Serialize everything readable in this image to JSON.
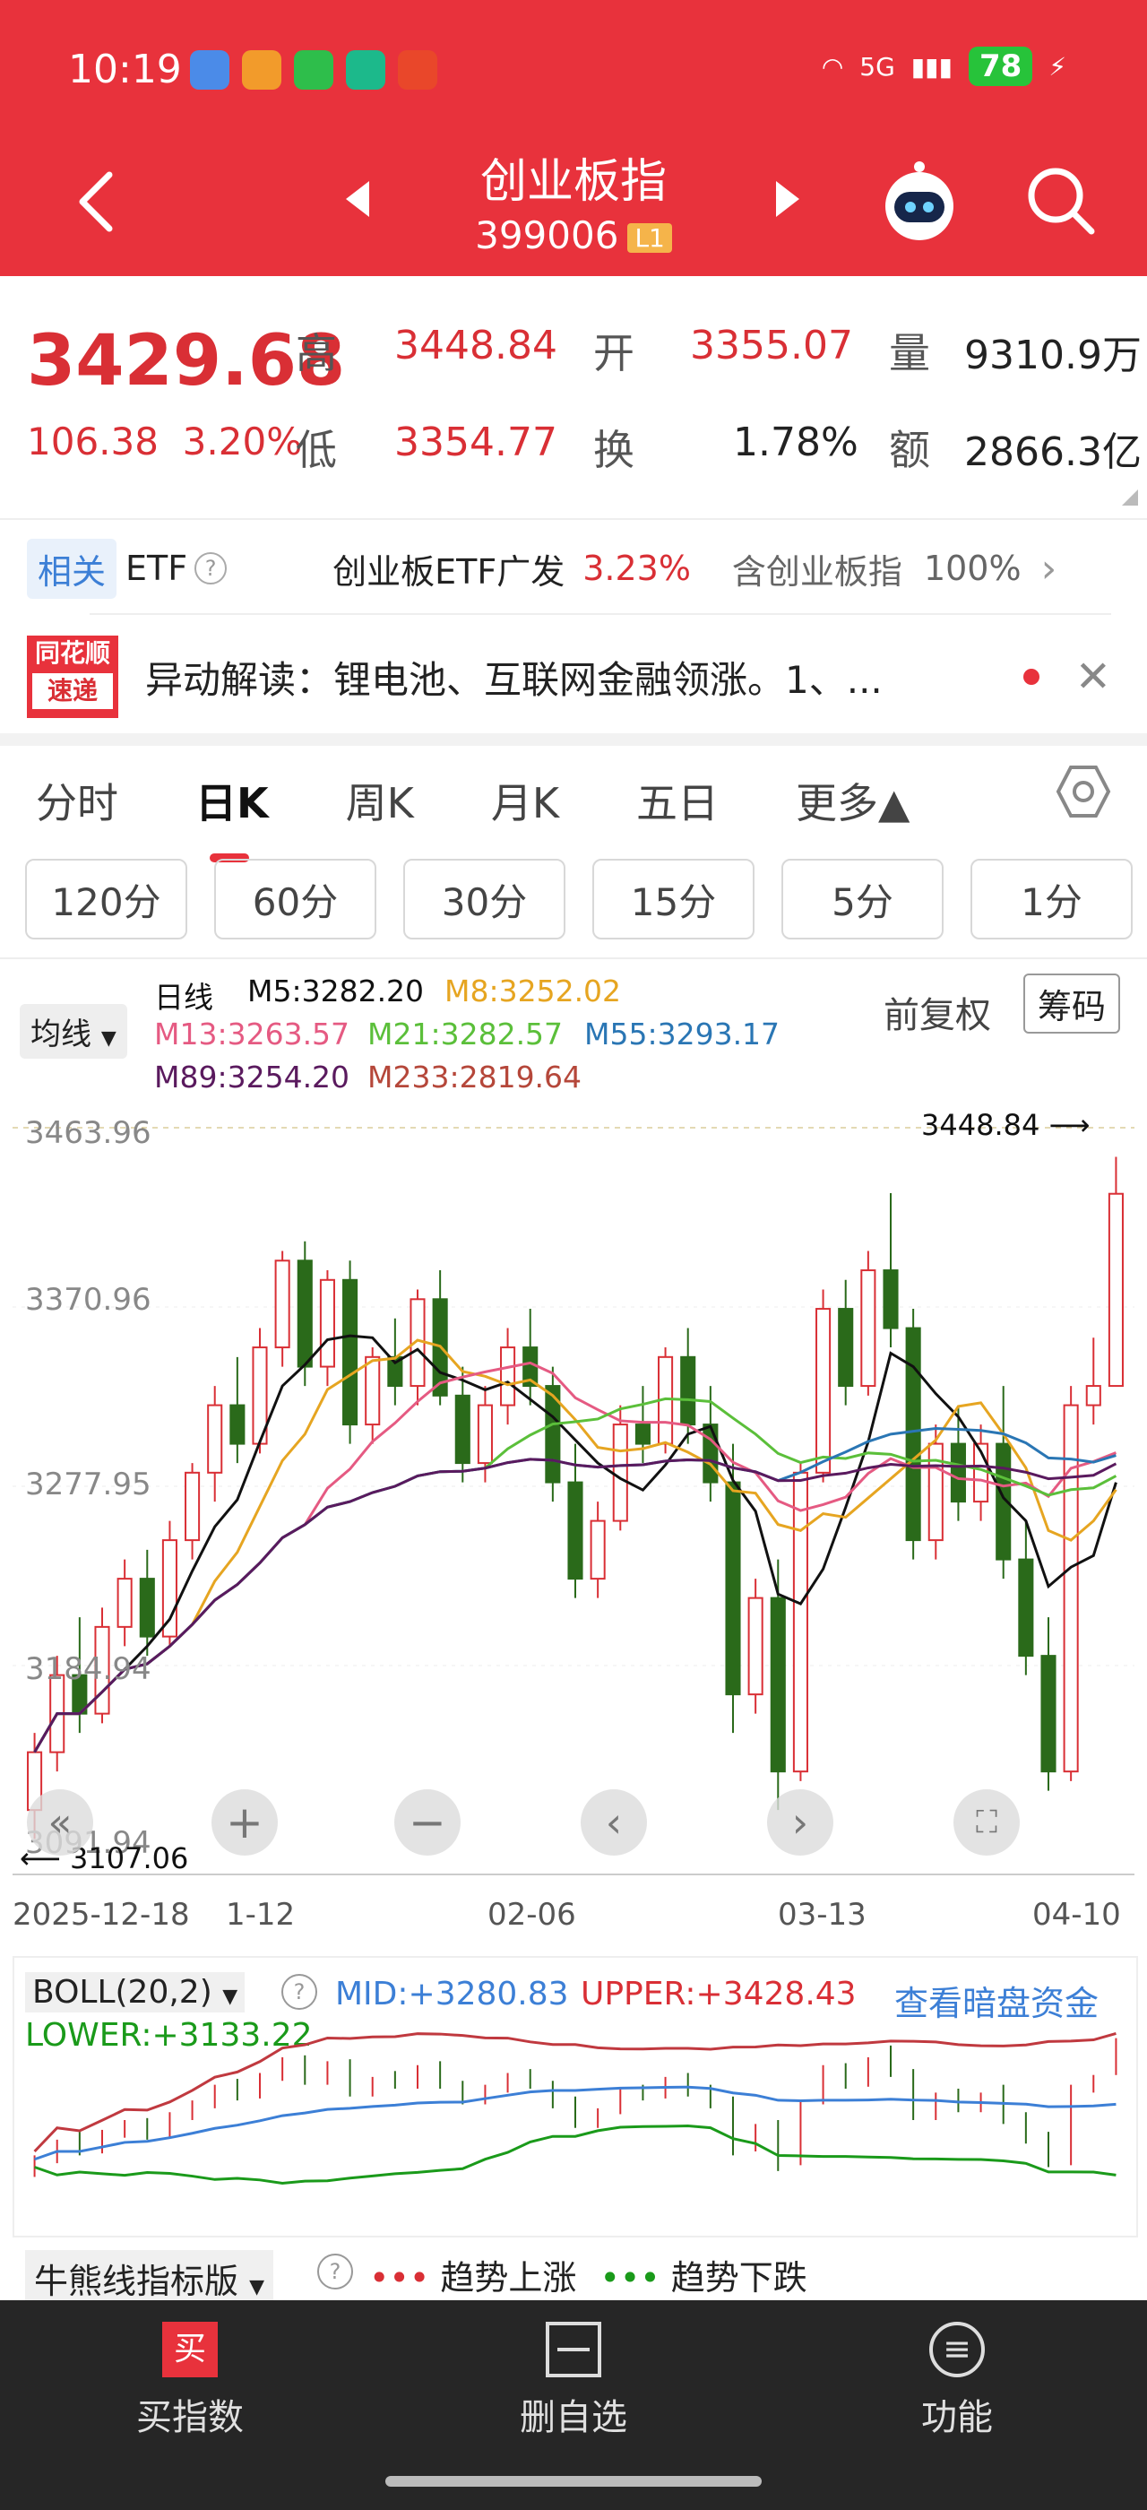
{
  "status_bar": {
    "time": "10:19",
    "signal": "5G",
    "battery": "78"
  },
  "header": {
    "title": "创业板指",
    "code": "399006",
    "level_badge": "L1",
    "icons": [
      "back-icon",
      "prev-icon",
      "next-icon",
      "robot-icon",
      "search-icon"
    ]
  },
  "quote": {
    "price": "3429.68",
    "change": "106.38",
    "change_pct": "3.20%",
    "high_label": "高",
    "high": "3448.84",
    "open_label": "开",
    "open": "3355.07",
    "volume_label": "量",
    "volume": "9310.9万",
    "low_label": "低",
    "low": "3354.77",
    "turnover_label": "换",
    "turnover": "1.78%",
    "amount_label": "额",
    "amount": "2866.3亿"
  },
  "etf": {
    "tag": "相关",
    "label": "ETF",
    "name": "创业板ETF广发",
    "pct": "3.23%",
    "contains": "含创业板指",
    "weight": "100%"
  },
  "news": {
    "logo_top": "同花顺",
    "logo_bottom": "速递",
    "text": "异动解读：锂电池、互联网金融领涨。1、..."
  },
  "tabs": {
    "items": [
      "分时",
      "日K",
      "周K",
      "月K",
      "五日",
      "更多▲"
    ],
    "active": "日K"
  },
  "periods": [
    "120分",
    "60分",
    "30分",
    "15分",
    "5分",
    "1分"
  ],
  "chart_panel": {
    "ma_dropdown": "均线",
    "line_type": "日线",
    "ma_values": [
      {
        "label": "M5:3282.20",
        "color": "#111111"
      },
      {
        "label": "M8:3252.02",
        "color": "#e6a521"
      },
      {
        "label": "M13:3263.57",
        "color": "#e55a82"
      },
      {
        "label": "M21:3282.57",
        "color": "#5bbf3a"
      },
      {
        "label": "M55:3293.17",
        "color": "#2a76b4"
      },
      {
        "label": "M89:3254.20",
        "color": "#5a1a5e"
      },
      {
        "label": "M233:2819.64",
        "color": "#b5473a"
      }
    ],
    "adjust": "前复权",
    "chips_button": "筹码",
    "price_axis": [
      "3463.96",
      "3370.96",
      "3277.95",
      "3184.94",
      "3091.94"
    ],
    "max_marker": "3448.84",
    "min_marker": "3107.06",
    "date_axis": [
      "2025-12-18",
      "1-12",
      "02-06",
      "03-13",
      "04-10"
    ]
  },
  "chart_data": {
    "type": "candlestick",
    "ylim": [
      3091.94,
      3463.96
    ],
    "x": [
      "2025-12-18",
      "1-12",
      "02-06",
      "03-13",
      "04-10"
    ],
    "ohlc": [
      [
        3110,
        3150,
        3095,
        3140
      ],
      [
        3140,
        3190,
        3130,
        3180
      ],
      [
        3180,
        3210,
        3150,
        3160
      ],
      [
        3160,
        3215,
        3155,
        3205
      ],
      [
        3205,
        3240,
        3195,
        3230
      ],
      [
        3230,
        3245,
        3190,
        3200
      ],
      [
        3200,
        3260,
        3195,
        3250
      ],
      [
        3250,
        3290,
        3240,
        3285
      ],
      [
        3285,
        3330,
        3270,
        3320
      ],
      [
        3320,
        3345,
        3290,
        3300
      ],
      [
        3300,
        3360,
        3295,
        3350
      ],
      [
        3350,
        3400,
        3340,
        3395
      ],
      [
        3395,
        3405,
        3330,
        3340
      ],
      [
        3340,
        3390,
        3330,
        3385
      ],
      [
        3385,
        3395,
        3300,
        3310
      ],
      [
        3310,
        3350,
        3300,
        3345
      ],
      [
        3345,
        3365,
        3320,
        3330
      ],
      [
        3330,
        3380,
        3320,
        3375
      ],
      [
        3375,
        3390,
        3320,
        3325
      ],
      [
        3325,
        3340,
        3280,
        3290
      ],
      [
        3290,
        3330,
        3280,
        3320
      ],
      [
        3320,
        3360,
        3310,
        3350
      ],
      [
        3350,
        3370,
        3320,
        3330
      ],
      [
        3330,
        3340,
        3270,
        3280
      ],
      [
        3280,
        3300,
        3220,
        3230
      ],
      [
        3230,
        3270,
        3220,
        3260
      ],
      [
        3260,
        3320,
        3255,
        3310
      ],
      [
        3310,
        3330,
        3290,
        3300
      ],
      [
        3300,
        3350,
        3295,
        3345
      ],
      [
        3345,
        3360,
        3300,
        3310
      ],
      [
        3310,
        3330,
        3270,
        3280
      ],
      [
        3280,
        3300,
        3150,
        3170
      ],
      [
        3170,
        3230,
        3160,
        3220
      ],
      [
        3220,
        3240,
        3110,
        3130
      ],
      [
        3130,
        3290,
        3125,
        3285
      ],
      [
        3285,
        3380,
        3280,
        3370
      ],
      [
        3370,
        3385,
        3320,
        3330
      ],
      [
        3330,
        3400,
        3325,
        3390
      ],
      [
        3390,
        3430,
        3350,
        3360
      ],
      [
        3360,
        3370,
        3240,
        3250
      ],
      [
        3250,
        3310,
        3240,
        3300
      ],
      [
        3300,
        3320,
        3260,
        3270
      ],
      [
        3270,
        3310,
        3260,
        3300
      ],
      [
        3300,
        3330,
        3230,
        3240
      ],
      [
        3240,
        3260,
        3180,
        3190
      ],
      [
        3190,
        3210,
        3120,
        3130
      ],
      [
        3130,
        3330,
        3125,
        3320
      ],
      [
        3320,
        3355,
        3310,
        3330
      ],
      [
        3330,
        3448.84,
        3354.77,
        3429.68
      ]
    ]
  },
  "boll": {
    "label": "BOLL(20,2)",
    "mid": "MID:+3280.83",
    "upper": "UPPER:+3428.43",
    "lower": "LOWER:+3133.22",
    "link": "查看暗盘资金"
  },
  "bull_bear": {
    "label": "牛熊线指标版",
    "up": "趋势上涨",
    "down": "趋势下跌"
  },
  "bottom_nav": [
    {
      "label": "买指数",
      "icon": "buy-icon"
    },
    {
      "label": "删自选",
      "icon": "remove-watchlist-icon"
    },
    {
      "label": "功能",
      "icon": "menu-icon"
    }
  ]
}
